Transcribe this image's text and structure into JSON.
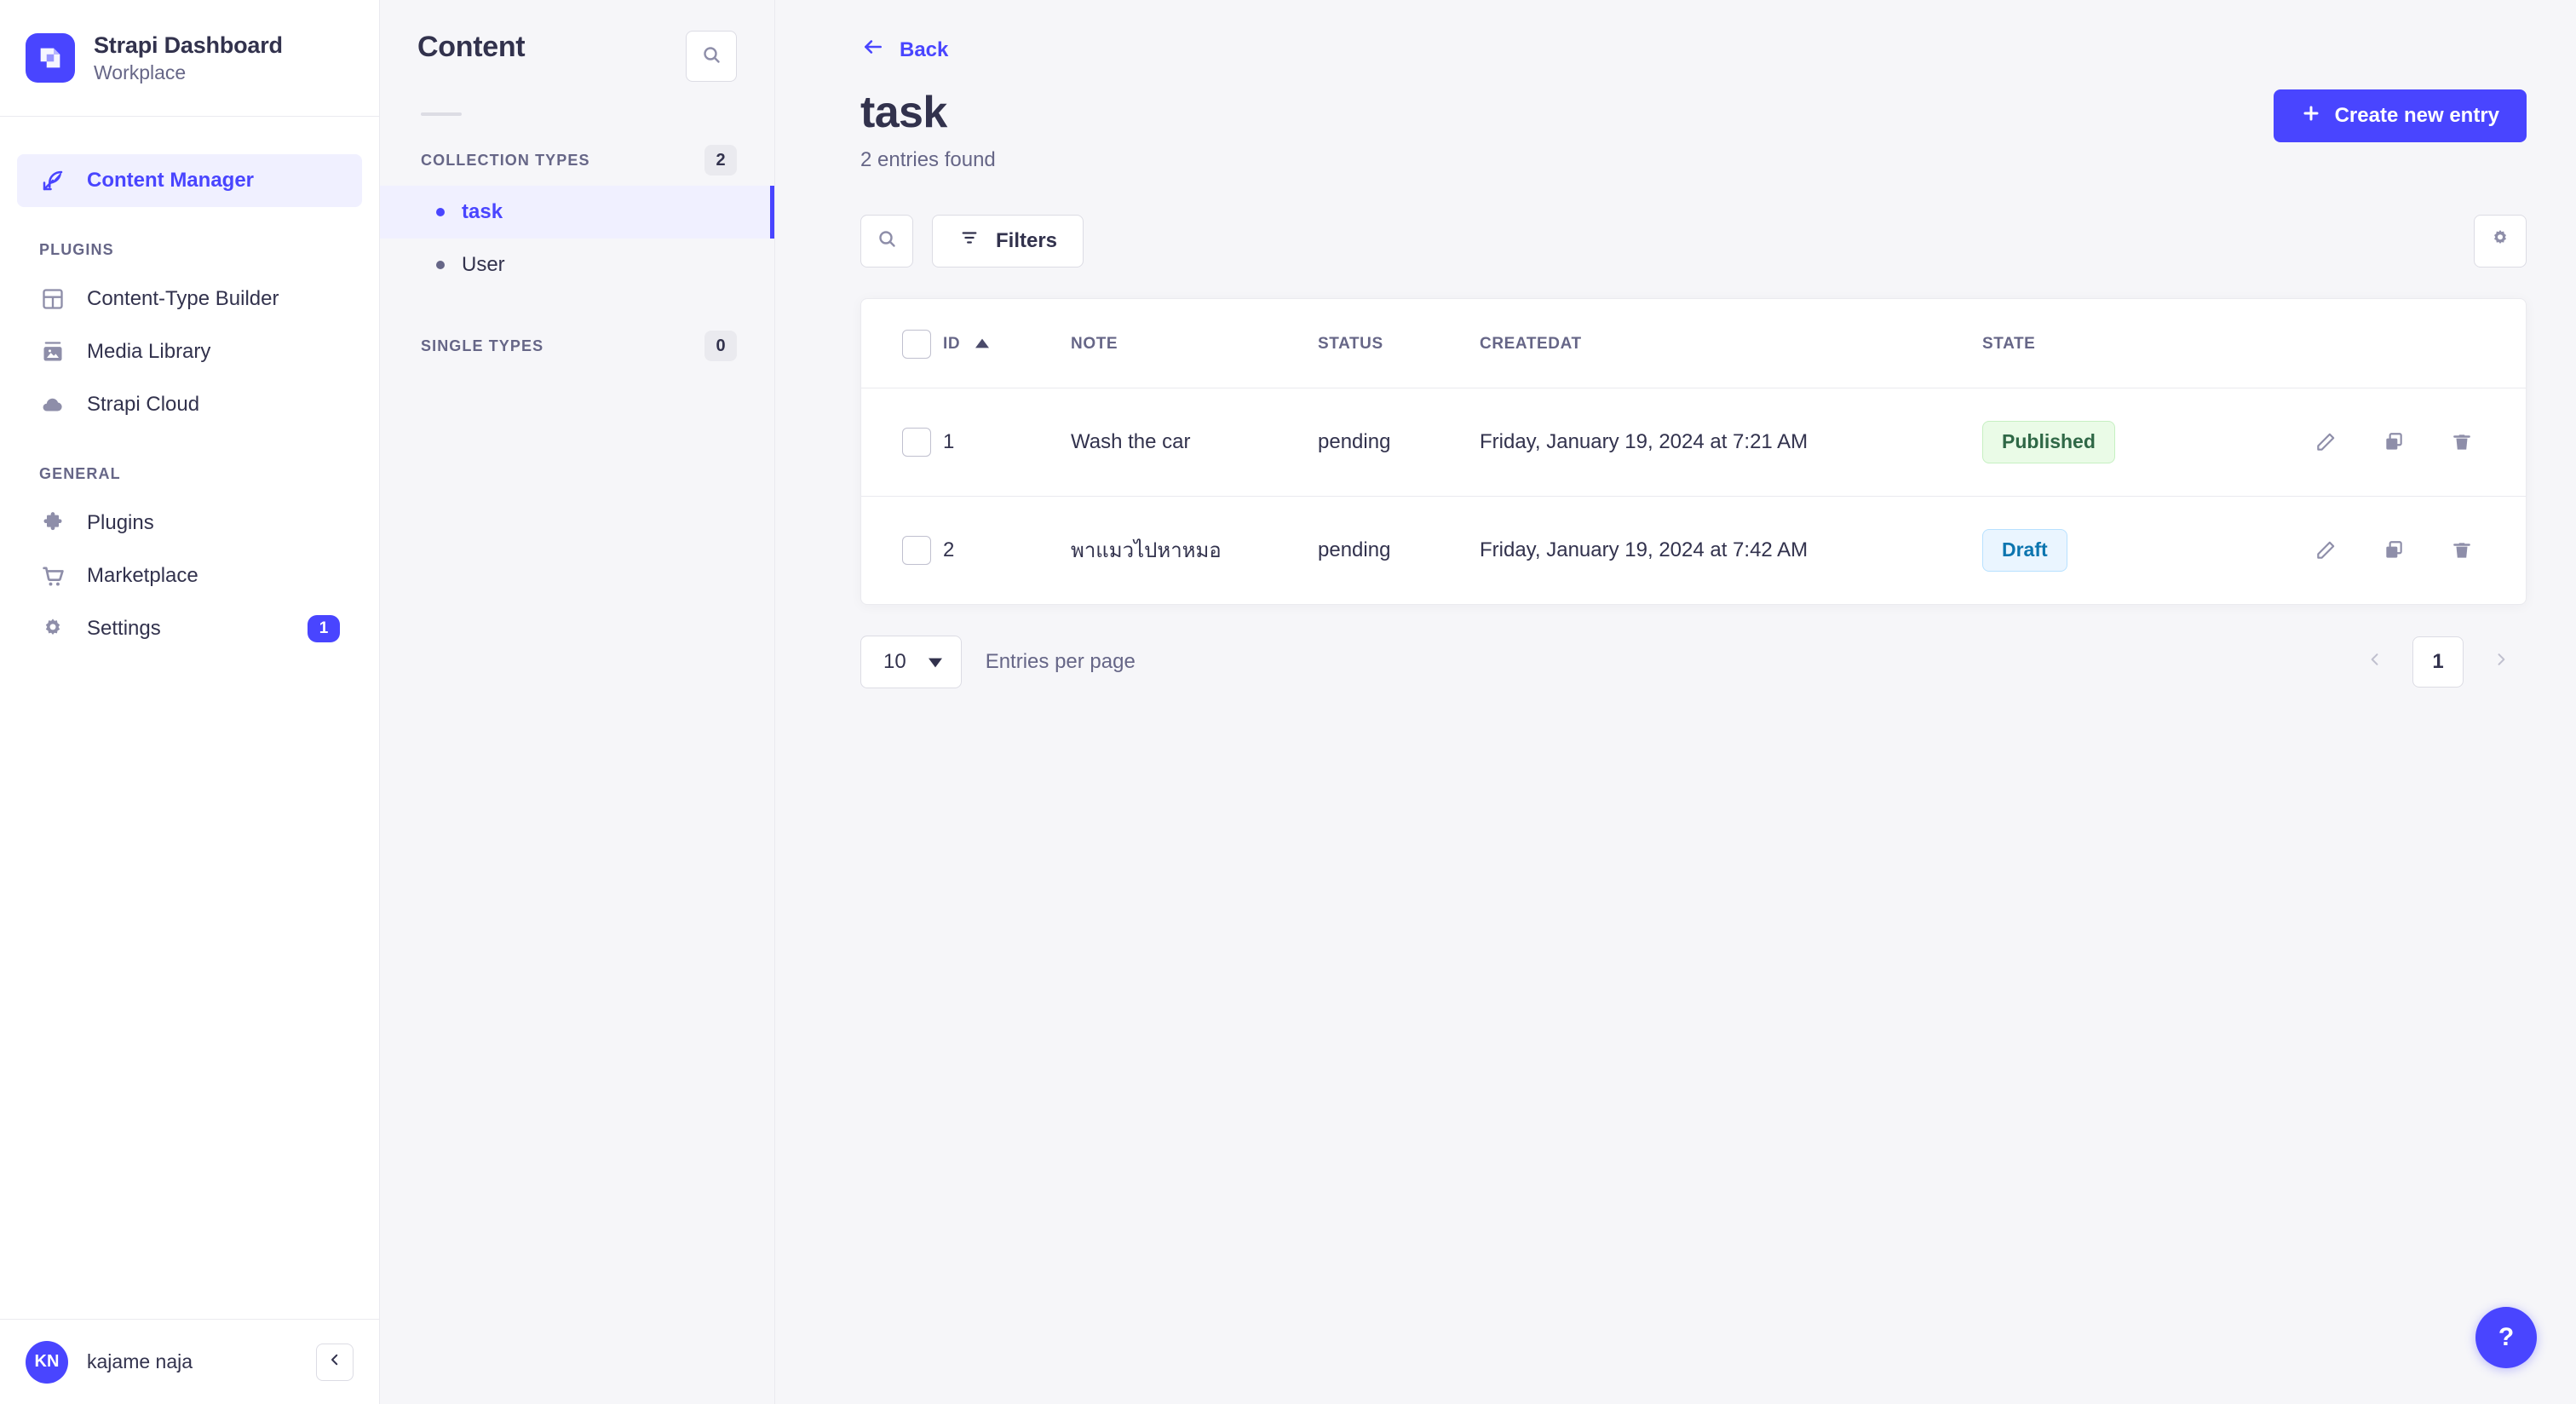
{
  "brand": {
    "title": "Strapi Dashboard",
    "subtitle": "Workplace",
    "logo_color": "#4945ff"
  },
  "nav": {
    "primary": [
      {
        "label": "Content Manager",
        "icon": "feather-icon",
        "active": true
      }
    ],
    "sections": [
      {
        "label": "PLUGINS",
        "items": [
          {
            "label": "Content-Type Builder",
            "icon": "layout-icon"
          },
          {
            "label": "Media Library",
            "icon": "image-icon"
          },
          {
            "label": "Strapi Cloud",
            "icon": "cloud-icon"
          }
        ]
      },
      {
        "label": "GENERAL",
        "items": [
          {
            "label": "Plugins",
            "icon": "puzzle-icon"
          },
          {
            "label": "Marketplace",
            "icon": "cart-icon"
          },
          {
            "label": "Settings",
            "icon": "gear-icon",
            "badge": "1"
          }
        ]
      }
    ],
    "footer": {
      "avatar_initials": "KN",
      "user_name": "kajame naja",
      "collapse_icon": "chevron-left-icon"
    }
  },
  "content_types": {
    "title": "Content",
    "search_icon": "search-icon",
    "groups": [
      {
        "label": "COLLECTION TYPES",
        "count": "2",
        "items": [
          {
            "label": "task",
            "active": true
          },
          {
            "label": "User",
            "active": false
          }
        ]
      },
      {
        "label": "SINGLE TYPES",
        "count": "0",
        "items": []
      }
    ]
  },
  "main": {
    "back_label": "Back",
    "page_title": "task",
    "entries_found": "2 entries found",
    "create_button": "Create new entry",
    "toolbar": {
      "search_icon": "search-icon",
      "filters_label": "Filters",
      "settings_icon": "gear-icon"
    },
    "table": {
      "columns": [
        {
          "key": "id",
          "label": "ID",
          "sorted": "asc"
        },
        {
          "key": "note",
          "label": "NOTE"
        },
        {
          "key": "status",
          "label": "STATUS"
        },
        {
          "key": "createdat",
          "label": "CREATEDAT"
        },
        {
          "key": "state",
          "label": "STATE"
        }
      ],
      "rows": [
        {
          "id": "1",
          "note": "Wash the car",
          "status": "pending",
          "createdat": "Friday, January 19, 2024 at 7:21 AM",
          "state": "Published",
          "state_kind": "published"
        },
        {
          "id": "2",
          "note": "พาแมวไปหาหมอ",
          "status": "pending",
          "createdat": "Friday, January 19, 2024 at 7:42 AM",
          "state": "Draft",
          "state_kind": "draft"
        }
      ],
      "row_actions": [
        "edit-icon",
        "duplicate-icon",
        "delete-icon"
      ]
    },
    "pagination": {
      "page_size": "10",
      "entries_per_page_label": "Entries per page",
      "current_page": "1",
      "prev_icon": "chevron-left-icon",
      "next_icon": "chevron-right-icon"
    },
    "help_label": "?"
  },
  "colors": {
    "accent": "#4945ff",
    "published_bg": "#eafbe7",
    "published_text": "#2f6846",
    "draft_bg": "#eaf5ff",
    "draft_text": "#0c75af",
    "page_bg": "#f6f6f9"
  }
}
